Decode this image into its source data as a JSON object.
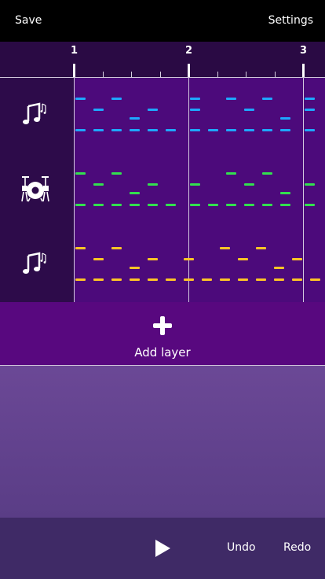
{
  "header": {
    "save_label": "Save",
    "settings_label": "Settings"
  },
  "ruler": {
    "bars": [
      "1",
      "2",
      "3"
    ]
  },
  "tracks": [
    {
      "name": "track-melody-1",
      "icon": "music-notes-icon",
      "color": "#1ea7ff"
    },
    {
      "name": "track-drums",
      "icon": "drum-kit-icon",
      "color": "#33e04f"
    },
    {
      "name": "track-melody-2",
      "icon": "music-notes-icon",
      "color": "#ffc526"
    }
  ],
  "add_layer": {
    "label": "Add layer",
    "icon": "plus-icon"
  },
  "footer": {
    "play_icon": "play-icon",
    "undo_label": "Undo",
    "redo_label": "Redo"
  },
  "colors": {
    "track_bg": "#4c0a7b",
    "header_bg": "#2d0b4a",
    "add_layer_bg": "#58087f",
    "footer_bg": "#3f2a66"
  }
}
